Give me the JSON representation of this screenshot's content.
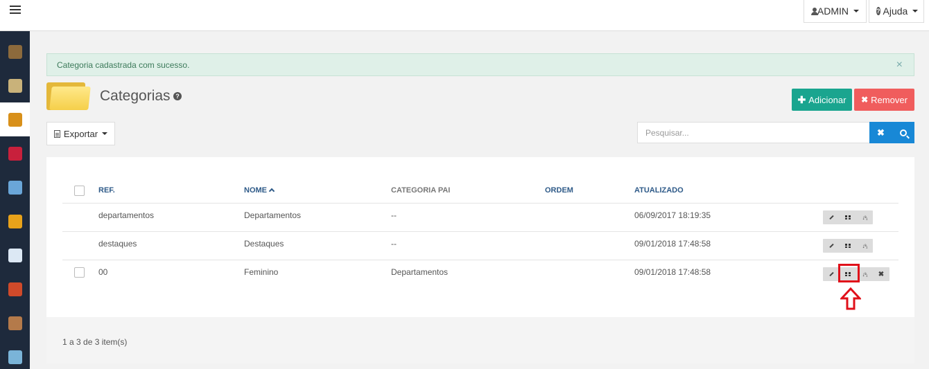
{
  "topbar": {
    "user_label": "ADMIN",
    "help_label": "Ajuda"
  },
  "sidebar": {
    "items": [
      {
        "icon": "product-icon",
        "color": "#8c6a3c"
      },
      {
        "icon": "catalog-icon",
        "color": "#c9b27a"
      },
      {
        "icon": "category-box-icon",
        "color": "#d8901a",
        "active": true
      },
      {
        "icon": "discount-icon",
        "color": "#c8203c"
      },
      {
        "icon": "banner-icon",
        "color": "#6aa6d8"
      },
      {
        "icon": "shipping-truck-icon",
        "color": "#e8a21a"
      },
      {
        "icon": "orders-icon",
        "color": "#dce8f4"
      },
      {
        "icon": "customers-icon",
        "color": "#d04a2a"
      },
      {
        "icon": "users-icon",
        "color": "#b47a4a"
      },
      {
        "icon": "settings-image-icon",
        "color": "#7ab4d8"
      }
    ]
  },
  "alert": {
    "message": "Categoria cadastrada com sucesso.",
    "close": "×"
  },
  "header": {
    "title": "Categorias",
    "add_label": "Adicionar",
    "remove_label": "Remover"
  },
  "toolbar": {
    "export_label": "Exportar",
    "search_placeholder": "Pesquisar..."
  },
  "table": {
    "columns": [
      "REF.",
      "NOME",
      "CATEGORIA PAI",
      "ORDEM",
      "ATUALIZADO"
    ],
    "rows": [
      {
        "ref": "departamentos",
        "nome": "Departamentos",
        "pai": "--",
        "ordem": "",
        "atualizado": "06/09/2017 18:19:35",
        "checkbox": false
      },
      {
        "ref": "destaques",
        "nome": "Destaques",
        "pai": "--",
        "ordem": "",
        "atualizado": "09/01/2018 17:48:58",
        "checkbox": false
      },
      {
        "ref": "00",
        "nome": "Feminino",
        "pai": "Departamentos",
        "ordem": "",
        "atualizado": "09/01/2018 17:48:58",
        "checkbox": true
      }
    ]
  },
  "footer": {
    "summary": "1 a 3 de 3 item(s)"
  },
  "colors": {
    "accent_add": "#1aa58f",
    "accent_remove": "#f05d5d",
    "accent_search": "#1888d6",
    "highlight": "#e0101a"
  }
}
